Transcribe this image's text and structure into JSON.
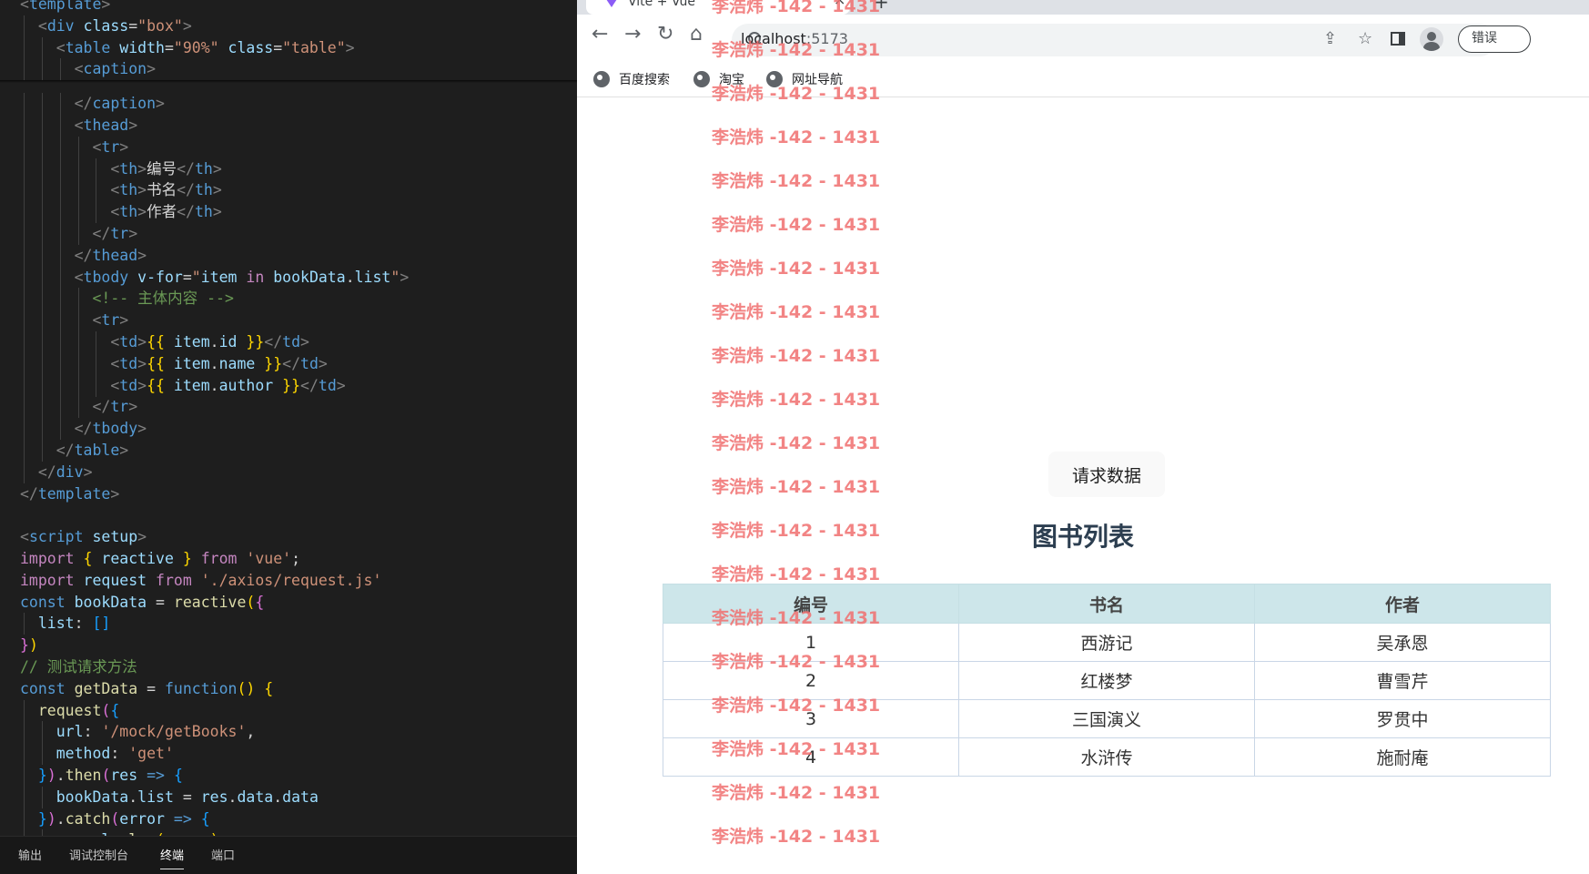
{
  "editor": {
    "lines": [
      [
        {
          "c": "t-bracket",
          "t": "<"
        },
        {
          "c": "t-tag",
          "t": "template"
        },
        {
          "c": "t-bracket",
          "t": ">"
        }
      ],
      [
        {
          "c": "t-text",
          "t": "  "
        },
        {
          "c": "t-bracket",
          "t": "<"
        },
        {
          "c": "t-tag",
          "t": "div"
        },
        {
          "c": "t-text",
          "t": " "
        },
        {
          "c": "t-attr",
          "t": "class"
        },
        {
          "c": "t-text",
          "t": "="
        },
        {
          "c": "t-str",
          "t": "\"box\""
        },
        {
          "c": "t-bracket",
          "t": ">"
        }
      ],
      [
        {
          "c": "t-text",
          "t": "    "
        },
        {
          "c": "t-bracket",
          "t": "<"
        },
        {
          "c": "t-tag",
          "t": "table"
        },
        {
          "c": "t-text",
          "t": " "
        },
        {
          "c": "t-attr",
          "t": "width"
        },
        {
          "c": "t-text",
          "t": "="
        },
        {
          "c": "t-str",
          "t": "\"90%\""
        },
        {
          "c": "t-text",
          "t": " "
        },
        {
          "c": "t-attr",
          "t": "class"
        },
        {
          "c": "t-text",
          "t": "="
        },
        {
          "c": "t-str",
          "t": "\"table\""
        },
        {
          "c": "t-bracket",
          "t": ">"
        }
      ],
      [
        {
          "c": "t-text",
          "t": "      "
        },
        {
          "c": "t-bracket",
          "t": "<"
        },
        {
          "c": "t-tag",
          "t": "caption"
        },
        {
          "c": "t-bracket",
          "t": ">"
        }
      ],
      [
        {
          "c": "t-text",
          "t": "      "
        },
        {
          "c": "t-bracket",
          "t": "</"
        },
        {
          "c": "t-tag",
          "t": "caption"
        },
        {
          "c": "t-bracket",
          "t": ">"
        }
      ],
      [
        {
          "c": "t-text",
          "t": "      "
        },
        {
          "c": "t-bracket",
          "t": "<"
        },
        {
          "c": "t-tag",
          "t": "thead"
        },
        {
          "c": "t-bracket",
          "t": ">"
        }
      ],
      [
        {
          "c": "t-text",
          "t": "        "
        },
        {
          "c": "t-bracket",
          "t": "<"
        },
        {
          "c": "t-tag",
          "t": "tr"
        },
        {
          "c": "t-bracket",
          "t": ">"
        }
      ],
      [
        {
          "c": "t-text",
          "t": "          "
        },
        {
          "c": "t-bracket",
          "t": "<"
        },
        {
          "c": "t-tag",
          "t": "th"
        },
        {
          "c": "t-bracket",
          "t": ">"
        },
        {
          "c": "t-text",
          "t": "编号"
        },
        {
          "c": "t-bracket",
          "t": "</"
        },
        {
          "c": "t-tag",
          "t": "th"
        },
        {
          "c": "t-bracket",
          "t": ">"
        }
      ],
      [
        {
          "c": "t-text",
          "t": "          "
        },
        {
          "c": "t-bracket",
          "t": "<"
        },
        {
          "c": "t-tag",
          "t": "th"
        },
        {
          "c": "t-bracket",
          "t": ">"
        },
        {
          "c": "t-text",
          "t": "书名"
        },
        {
          "c": "t-bracket",
          "t": "</"
        },
        {
          "c": "t-tag",
          "t": "th"
        },
        {
          "c": "t-bracket",
          "t": ">"
        }
      ],
      [
        {
          "c": "t-text",
          "t": "          "
        },
        {
          "c": "t-bracket",
          "t": "<"
        },
        {
          "c": "t-tag",
          "t": "th"
        },
        {
          "c": "t-bracket",
          "t": ">"
        },
        {
          "c": "t-text",
          "t": "作者"
        },
        {
          "c": "t-bracket",
          "t": "</"
        },
        {
          "c": "t-tag",
          "t": "th"
        },
        {
          "c": "t-bracket",
          "t": ">"
        }
      ],
      [
        {
          "c": "t-text",
          "t": "        "
        },
        {
          "c": "t-bracket",
          "t": "</"
        },
        {
          "c": "t-tag",
          "t": "tr"
        },
        {
          "c": "t-bracket",
          "t": ">"
        }
      ],
      [
        {
          "c": "t-text",
          "t": "      "
        },
        {
          "c": "t-bracket",
          "t": "</"
        },
        {
          "c": "t-tag",
          "t": "thead"
        },
        {
          "c": "t-bracket",
          "t": ">"
        }
      ],
      [
        {
          "c": "t-text",
          "t": "      "
        },
        {
          "c": "t-bracket",
          "t": "<"
        },
        {
          "c": "t-tag",
          "t": "tbody"
        },
        {
          "c": "t-text",
          "t": " "
        },
        {
          "c": "t-attr",
          "t": "v-for"
        },
        {
          "c": "t-text",
          "t": "="
        },
        {
          "c": "t-str",
          "t": "\""
        },
        {
          "c": "t-var",
          "t": "item"
        },
        {
          "c": "t-text",
          "t": " "
        },
        {
          "c": "t-kw",
          "t": "in"
        },
        {
          "c": "t-text",
          "t": " "
        },
        {
          "c": "t-var",
          "t": "bookData"
        },
        {
          "c": "t-text",
          "t": "."
        },
        {
          "c": "t-var",
          "t": "list"
        },
        {
          "c": "t-str",
          "t": "\""
        },
        {
          "c": "t-bracket",
          "t": ">"
        }
      ],
      [
        {
          "c": "t-text",
          "t": "        "
        },
        {
          "c": "t-cmt",
          "t": "<!-- 主体内容 -->"
        }
      ],
      [
        {
          "c": "t-text",
          "t": "        "
        },
        {
          "c": "t-bracket",
          "t": "<"
        },
        {
          "c": "t-tag",
          "t": "tr"
        },
        {
          "c": "t-bracket",
          "t": ">"
        }
      ],
      [
        {
          "c": "t-text",
          "t": "          "
        },
        {
          "c": "t-bracket",
          "t": "<"
        },
        {
          "c": "t-tag",
          "t": "td"
        },
        {
          "c": "t-bracket",
          "t": ">"
        },
        {
          "c": "t-brace",
          "t": "{{"
        },
        {
          "c": "t-text",
          "t": " "
        },
        {
          "c": "t-var",
          "t": "item"
        },
        {
          "c": "t-text",
          "t": "."
        },
        {
          "c": "t-var",
          "t": "id"
        },
        {
          "c": "t-text",
          "t": " "
        },
        {
          "c": "t-brace",
          "t": "}}"
        },
        {
          "c": "t-bracket",
          "t": "</"
        },
        {
          "c": "t-tag",
          "t": "td"
        },
        {
          "c": "t-bracket",
          "t": ">"
        }
      ],
      [
        {
          "c": "t-text",
          "t": "          "
        },
        {
          "c": "t-bracket",
          "t": "<"
        },
        {
          "c": "t-tag",
          "t": "td"
        },
        {
          "c": "t-bracket",
          "t": ">"
        },
        {
          "c": "t-brace",
          "t": "{{"
        },
        {
          "c": "t-text",
          "t": " "
        },
        {
          "c": "t-var",
          "t": "item"
        },
        {
          "c": "t-text",
          "t": "."
        },
        {
          "c": "t-var",
          "t": "name"
        },
        {
          "c": "t-text",
          "t": " "
        },
        {
          "c": "t-brace",
          "t": "}}"
        },
        {
          "c": "t-bracket",
          "t": "</"
        },
        {
          "c": "t-tag",
          "t": "td"
        },
        {
          "c": "t-bracket",
          "t": ">"
        }
      ],
      [
        {
          "c": "t-text",
          "t": "          "
        },
        {
          "c": "t-bracket",
          "t": "<"
        },
        {
          "c": "t-tag",
          "t": "td"
        },
        {
          "c": "t-bracket",
          "t": ">"
        },
        {
          "c": "t-brace",
          "t": "{{"
        },
        {
          "c": "t-text",
          "t": " "
        },
        {
          "c": "t-var",
          "t": "item"
        },
        {
          "c": "t-text",
          "t": "."
        },
        {
          "c": "t-var",
          "t": "author"
        },
        {
          "c": "t-text",
          "t": " "
        },
        {
          "c": "t-brace",
          "t": "}}"
        },
        {
          "c": "t-bracket",
          "t": "</"
        },
        {
          "c": "t-tag",
          "t": "td"
        },
        {
          "c": "t-bracket",
          "t": ">"
        }
      ],
      [
        {
          "c": "t-text",
          "t": "        "
        },
        {
          "c": "t-bracket",
          "t": "</"
        },
        {
          "c": "t-tag",
          "t": "tr"
        },
        {
          "c": "t-bracket",
          "t": ">"
        }
      ],
      [
        {
          "c": "t-text",
          "t": "      "
        },
        {
          "c": "t-bracket",
          "t": "</"
        },
        {
          "c": "t-tag",
          "t": "tbody"
        },
        {
          "c": "t-bracket",
          "t": ">"
        }
      ],
      [
        {
          "c": "t-text",
          "t": "    "
        },
        {
          "c": "t-bracket",
          "t": "</"
        },
        {
          "c": "t-tag",
          "t": "table"
        },
        {
          "c": "t-bracket",
          "t": ">"
        }
      ],
      [
        {
          "c": "t-text",
          "t": "  "
        },
        {
          "c": "t-bracket",
          "t": "</"
        },
        {
          "c": "t-tag",
          "t": "div"
        },
        {
          "c": "t-bracket",
          "t": ">"
        }
      ],
      [
        {
          "c": "t-bracket",
          "t": "</"
        },
        {
          "c": "t-tag",
          "t": "template"
        },
        {
          "c": "t-bracket",
          "t": ">"
        }
      ],
      [],
      [
        {
          "c": "t-bracket",
          "t": "<"
        },
        {
          "c": "t-tag",
          "t": "script"
        },
        {
          "c": "t-text",
          "t": " "
        },
        {
          "c": "t-attr",
          "t": "setup"
        },
        {
          "c": "t-bracket",
          "t": ">"
        }
      ],
      [
        {
          "c": "t-kw",
          "t": "import"
        },
        {
          "c": "t-text",
          "t": " "
        },
        {
          "c": "t-brace",
          "t": "{"
        },
        {
          "c": "t-text",
          "t": " "
        },
        {
          "c": "t-var",
          "t": "reactive"
        },
        {
          "c": "t-text",
          "t": " "
        },
        {
          "c": "t-brace",
          "t": "}"
        },
        {
          "c": "t-text",
          "t": " "
        },
        {
          "c": "t-kw",
          "t": "from"
        },
        {
          "c": "t-text",
          "t": " "
        },
        {
          "c": "t-str",
          "t": "'vue'"
        },
        {
          "c": "t-text",
          "t": ";"
        }
      ],
      [
        {
          "c": "t-kw",
          "t": "import"
        },
        {
          "c": "t-text",
          "t": " "
        },
        {
          "c": "t-var",
          "t": "request"
        },
        {
          "c": "t-text",
          "t": " "
        },
        {
          "c": "t-kw",
          "t": "from"
        },
        {
          "c": "t-text",
          "t": " "
        },
        {
          "c": "t-str",
          "t": "'./axios/request.js'"
        }
      ],
      [
        {
          "c": "t-decl",
          "t": "const"
        },
        {
          "c": "t-text",
          "t": " "
        },
        {
          "c": "t-var",
          "t": "bookData"
        },
        {
          "c": "t-text",
          "t": " = "
        },
        {
          "c": "t-fn",
          "t": "reactive"
        },
        {
          "c": "t-brace",
          "t": "("
        },
        {
          "c": "t-brace2",
          "t": "{"
        }
      ],
      [
        {
          "c": "t-text",
          "t": "  "
        },
        {
          "c": "t-var",
          "t": "list"
        },
        {
          "c": "t-text",
          "t": ": "
        },
        {
          "c": "t-brace3",
          "t": "[]"
        }
      ],
      [
        {
          "c": "t-brace2",
          "t": "}"
        },
        {
          "c": "t-brace",
          "t": ")"
        }
      ],
      [
        {
          "c": "t-cmt",
          "t": "// 测试请求方法"
        }
      ],
      [
        {
          "c": "t-decl",
          "t": "const"
        },
        {
          "c": "t-text",
          "t": " "
        },
        {
          "c": "t-fn",
          "t": "getData"
        },
        {
          "c": "t-text",
          "t": " = "
        },
        {
          "c": "t-decl",
          "t": "function"
        },
        {
          "c": "t-brace",
          "t": "()"
        },
        {
          "c": "t-text",
          "t": " "
        },
        {
          "c": "t-brace",
          "t": "{"
        }
      ],
      [
        {
          "c": "t-text",
          "t": "  "
        },
        {
          "c": "t-fn",
          "t": "request"
        },
        {
          "c": "t-brace2",
          "t": "("
        },
        {
          "c": "t-brace3",
          "t": "{"
        }
      ],
      [
        {
          "c": "t-text",
          "t": "    "
        },
        {
          "c": "t-var",
          "t": "url"
        },
        {
          "c": "t-text",
          "t": ": "
        },
        {
          "c": "t-str",
          "t": "'/mock/getBooks'"
        },
        {
          "c": "t-text",
          "t": ","
        }
      ],
      [
        {
          "c": "t-text",
          "t": "    "
        },
        {
          "c": "t-var",
          "t": "method"
        },
        {
          "c": "t-text",
          "t": ": "
        },
        {
          "c": "t-str",
          "t": "'get'"
        }
      ],
      [
        {
          "c": "t-text",
          "t": "  "
        },
        {
          "c": "t-brace3",
          "t": "}"
        },
        {
          "c": "t-brace2",
          "t": ")"
        },
        {
          "c": "t-text",
          "t": "."
        },
        {
          "c": "t-fn",
          "t": "then"
        },
        {
          "c": "t-brace2",
          "t": "("
        },
        {
          "c": "t-var",
          "t": "res"
        },
        {
          "c": "t-text",
          "t": " "
        },
        {
          "c": "t-decl",
          "t": "=>"
        },
        {
          "c": "t-text",
          "t": " "
        },
        {
          "c": "t-brace3",
          "t": "{"
        }
      ],
      [
        {
          "c": "t-text",
          "t": "    "
        },
        {
          "c": "t-var",
          "t": "bookData"
        },
        {
          "c": "t-text",
          "t": "."
        },
        {
          "c": "t-var",
          "t": "list"
        },
        {
          "c": "t-text",
          "t": " = "
        },
        {
          "c": "t-var",
          "t": "res"
        },
        {
          "c": "t-text",
          "t": "."
        },
        {
          "c": "t-var",
          "t": "data"
        },
        {
          "c": "t-text",
          "t": "."
        },
        {
          "c": "t-var",
          "t": "data"
        }
      ],
      [
        {
          "c": "t-text",
          "t": "  "
        },
        {
          "c": "t-brace3",
          "t": "}"
        },
        {
          "c": "t-brace2",
          "t": ")"
        },
        {
          "c": "t-text",
          "t": "."
        },
        {
          "c": "t-fn",
          "t": "catch"
        },
        {
          "c": "t-brace2",
          "t": "("
        },
        {
          "c": "t-var",
          "t": "error"
        },
        {
          "c": "t-text",
          "t": " "
        },
        {
          "c": "t-decl",
          "t": "=>"
        },
        {
          "c": "t-text",
          "t": " "
        },
        {
          "c": "t-brace3",
          "t": "{"
        }
      ],
      [
        {
          "c": "t-text",
          "t": "    "
        },
        {
          "c": "t-var",
          "t": "console"
        },
        {
          "c": "t-text",
          "t": "."
        },
        {
          "c": "t-fn",
          "t": "log"
        },
        {
          "c": "t-brace",
          "t": "("
        },
        {
          "c": "t-var",
          "t": "error"
        },
        {
          "c": "t-brace",
          "t": ")"
        }
      ]
    ]
  },
  "panel_tabs": [
    "输出",
    "调试控制台",
    "终端",
    "端口"
  ],
  "panel_active": "终端",
  "browser": {
    "tab_title": "Vite + Vue",
    "tab_close": "×",
    "new_tab": "+",
    "back_icon": "←",
    "forward_icon": "→",
    "reload_icon": "↻",
    "home_icon": "⌂",
    "url_host": "localhost",
    "url_port": ":5173",
    "share_icon": "⇪",
    "star_icon": "☆",
    "error_button": "错误",
    "bookmarks": [
      "百度搜索",
      "淘宝",
      "网址导航"
    ]
  },
  "page": {
    "fetch_button": "请求数据",
    "list_title": "图书列表",
    "columns": [
      "编号",
      "书名",
      "作者"
    ],
    "rows": [
      [
        "1",
        "西游记",
        "吴承恩"
      ],
      [
        "2",
        "红楼梦",
        "曹雪芹"
      ],
      [
        "3",
        "三国演义",
        "罗贯中"
      ],
      [
        "4",
        "水浒传",
        "施耐庵"
      ]
    ]
  },
  "watermark": {
    "text": "李浩炜 -142 - 1431",
    "count": 20,
    "color": "#f06e6e"
  },
  "colors": {
    "editor_bg": "#1e1e1e",
    "table_header_bg": "#cde6ea",
    "title_color": "#2c3e50"
  }
}
